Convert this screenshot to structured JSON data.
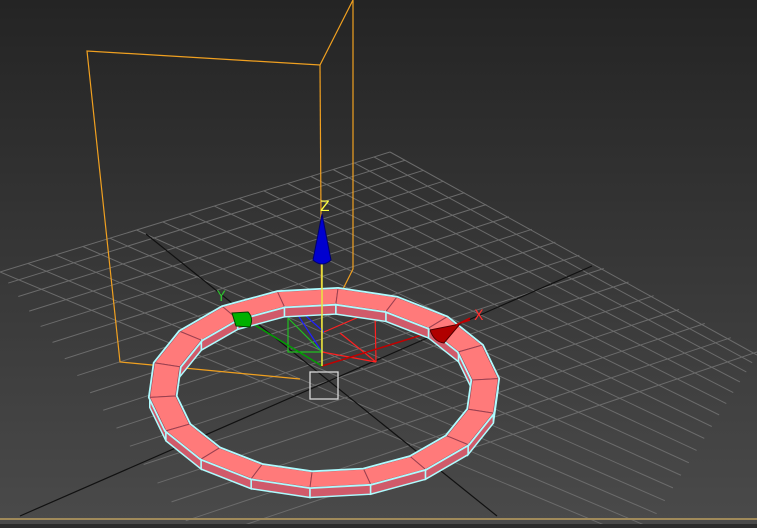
{
  "viewport": {
    "gizmo": {
      "x_label": "X",
      "y_label": "Y",
      "z_label": "Z"
    },
    "colors": {
      "background_top": "#262626",
      "background_bottom": "#4a4a4a",
      "grid": "#6a6a6a",
      "grid_axis": "#000000",
      "bounding_box": "#f0a020",
      "ring_fill": "#ff7a7a",
      "ring_outline": "#aefcff",
      "ring_side": "#d05a6a",
      "axis_x": "#c00000",
      "axis_y": "#00a000",
      "axis_z": "#0000c8",
      "axis_z_label": "#ffff40",
      "axis_x_label": "#ff3030",
      "axis_y_label": "#30c030",
      "pivot_box": "#d8d8d8",
      "bottom_border": "#a08a5a"
    }
  }
}
